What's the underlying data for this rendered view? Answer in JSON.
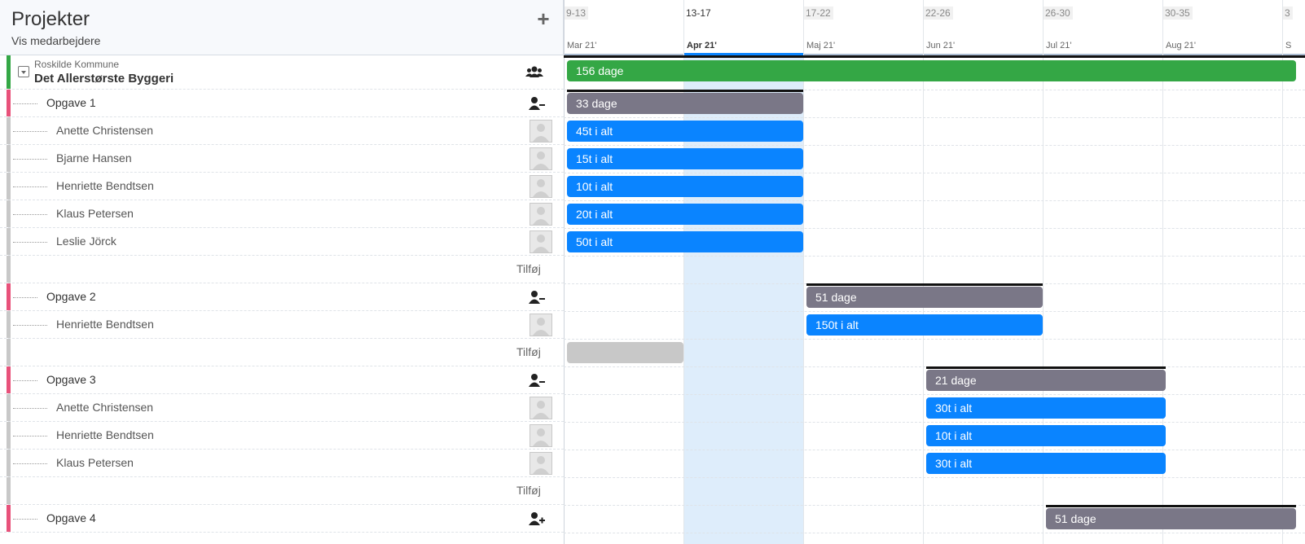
{
  "header": {
    "title": "Projekter",
    "subtitle": "Vis medarbejdere"
  },
  "timeline": {
    "weeks": [
      "9-13",
      "13-17",
      "17-22",
      "22-26",
      "26-30",
      "30-35",
      "3"
    ],
    "months": [
      "Mar 21'",
      "Apr 21'",
      "Maj 21'",
      "Jun 21'",
      "Jul 21'",
      "Aug 21'",
      "S"
    ],
    "highlighted_week": "13-17"
  },
  "project": {
    "client": "Roskilde Kommune",
    "name": "Det Allerstørste Byggeri",
    "bar_label": "156 dage",
    "color": "#34a745"
  },
  "rows": {
    "t1": {
      "label": "Opgave 1",
      "bar": "33 dage"
    },
    "t1p1": {
      "label": "Anette Christensen",
      "bar": "45t i alt"
    },
    "t1p2": {
      "label": "Bjarne Hansen",
      "bar": "15t i alt"
    },
    "t1p3": {
      "label": "Henriette Bendtsen",
      "bar": "10t i alt"
    },
    "t1p4": {
      "label": "Klaus Petersen",
      "bar": "20t i alt"
    },
    "t1p5": {
      "label": "Leslie Jörck",
      "bar": "50t i alt"
    },
    "t1add": {
      "label": "Tilføj"
    },
    "t2": {
      "label": "Opgave 2",
      "bar": "51 dage"
    },
    "t2p1": {
      "label": "Henriette Bendtsen",
      "bar": "150t i alt"
    },
    "t2add": {
      "label": "Tilføj"
    },
    "t3": {
      "label": "Opgave 3",
      "bar": "21 dage"
    },
    "t3p1": {
      "label": "Anette Christensen",
      "bar": "30t i alt"
    },
    "t3p2": {
      "label": "Henriette Bendtsen",
      "bar": "10t i alt"
    },
    "t3p3": {
      "label": "Klaus Petersen",
      "bar": "30t i alt"
    },
    "t3add": {
      "label": "Tilføj"
    },
    "t4": {
      "label": "Opgave 4",
      "bar": "51 dage"
    }
  },
  "colors": {
    "task_bar": "#7a7787",
    "person_bar": "#0a84ff",
    "task_accent": "#e8517a",
    "project_accent": "#34a745",
    "empty_bar": "#c8c8c8",
    "highlight": "#deedfb"
  },
  "icons": {
    "add": "plus-icon",
    "group": "users-icon",
    "remove_person": "user-minus-icon",
    "add_person": "user-plus-icon",
    "avatar": "placeholder-avatar-icon",
    "collapse": "collapse-icon"
  }
}
